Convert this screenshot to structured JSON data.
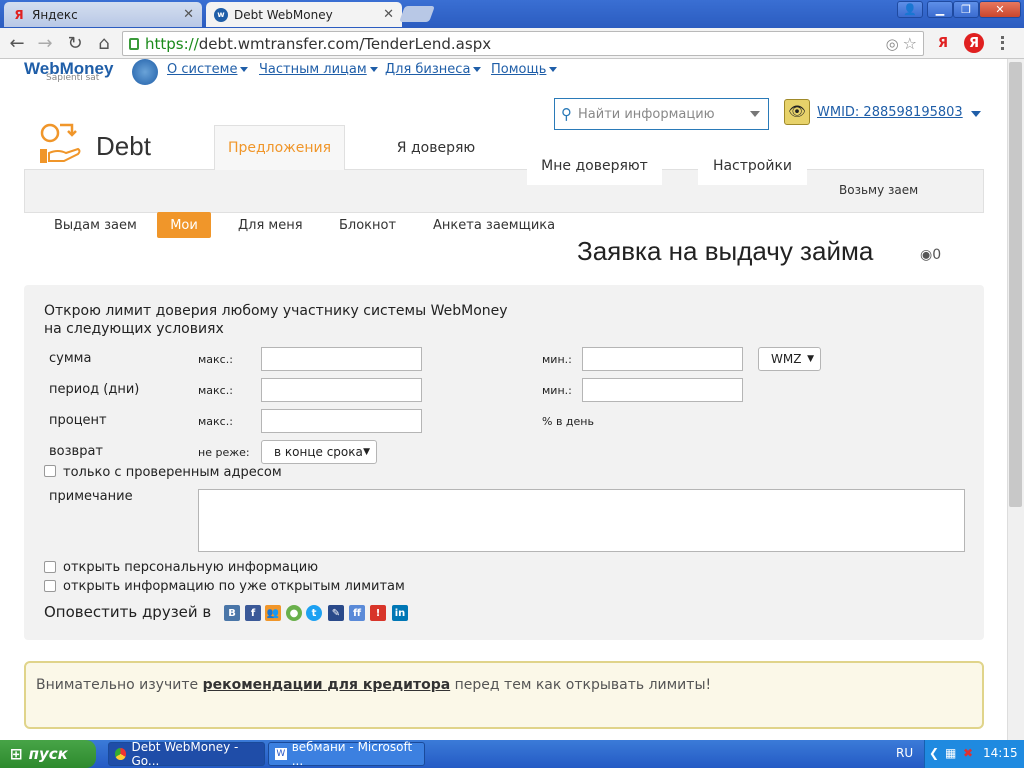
{
  "browser": {
    "tabs": [
      {
        "label": "Яндекс",
        "favicon": "yandex-icon",
        "active": false
      },
      {
        "label": "Debt WebMoney",
        "favicon": "webmoney-icon",
        "active": true
      }
    ],
    "url_scheme": "https://",
    "url_rest": "debt.wmtransfer.com/TenderLend.aspx",
    "ya_label": "Я"
  },
  "site": {
    "logo": "WebMoney",
    "logo_sub": "Sapienti sat",
    "nav": [
      "О системе",
      "Частным лицам",
      "Для бизнеса",
      "Помощь"
    ],
    "search_placeholder": "Найти информацию",
    "wmid": "WMID: 288598195803"
  },
  "debt": {
    "title": "Debt",
    "main_tabs": [
      "Предложения",
      "Я доверяю",
      "Мне доверяют",
      "Настройки"
    ],
    "take_loan": "Возьму заем",
    "sub_tabs": [
      "Выдам заем",
      "Мои",
      "Для меня",
      "Блокнот",
      "Анкета заемщика"
    ],
    "active_sub_tab": "Мои"
  },
  "form": {
    "heading": "Заявка на выдачу займа",
    "views": "0",
    "intro_line1": "Открою лимит доверия  любому участнику системы WebMoney",
    "intro_line2": "на следующих условиях",
    "rows": {
      "sum_label": "сумма",
      "period_label": "период (дни)",
      "percent_label": "процент",
      "return_label": "возврат",
      "max": "макс.:",
      "min": "мин.:",
      "not_less": "не реже:",
      "percent_unit": "% в день",
      "currency": "WMZ",
      "return_value": "в конце срока"
    },
    "checkbox_verified": "только с проверенным адресом",
    "note_label": "примечание",
    "checkbox_personal": "открыть персональную информацию",
    "checkbox_limits": "открыть информацию по уже открытым лимитам",
    "notify_label": "Оповестить друзей в"
  },
  "notice": {
    "before": "Внимательно изучите ",
    "link": "рекомендации для кредитора",
    "after": " перед тем как открывать лимиты!"
  },
  "taskbar": {
    "start": "пуск",
    "tasks": [
      "Debt WebMoney - Go...",
      "вебмани - Microsoft ..."
    ],
    "lang": "RU",
    "time": "14:15"
  }
}
